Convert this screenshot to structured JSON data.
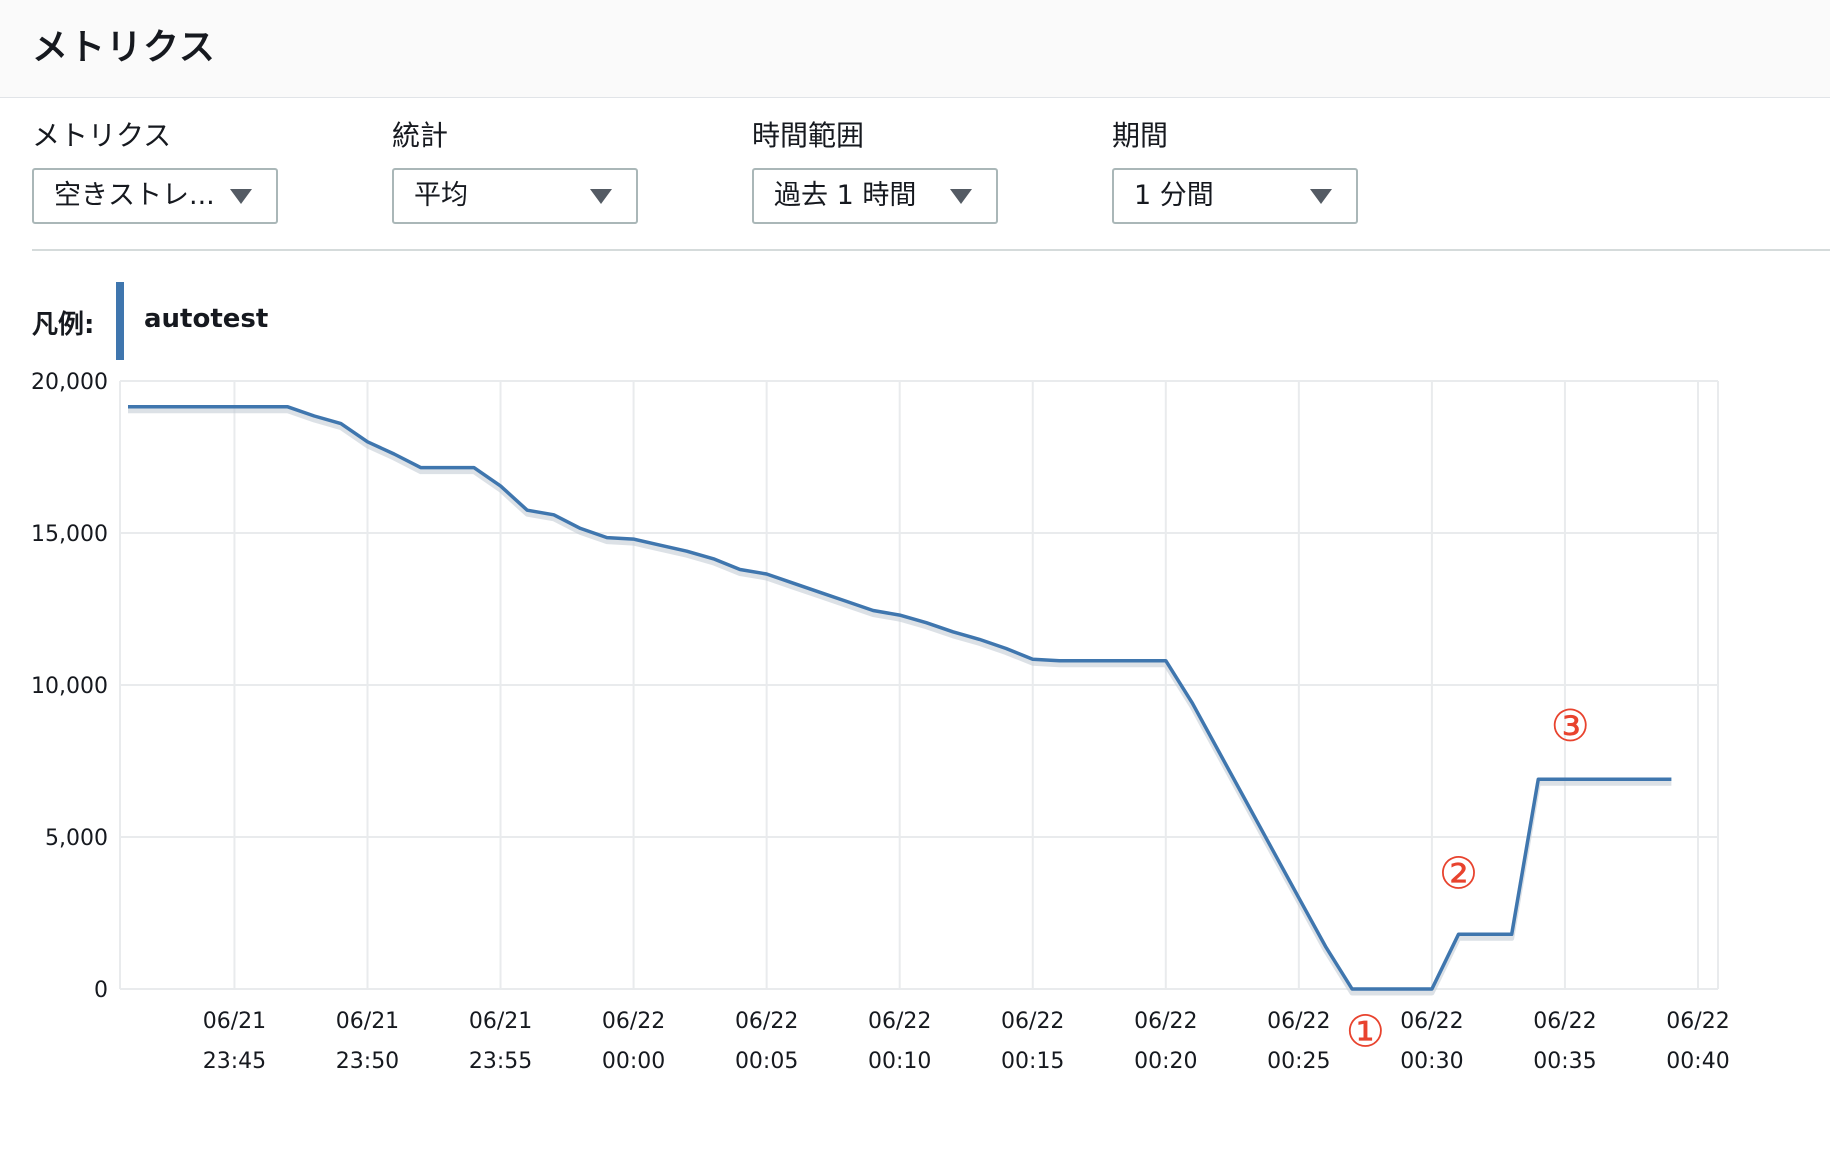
{
  "header": {
    "title": "メトリクス"
  },
  "filters": [
    {
      "label": "メトリクス",
      "value": "空きストレ..."
    },
    {
      "label": "統計",
      "value": "平均"
    },
    {
      "label": "時間範囲",
      "value": "過去 1 時間"
    },
    {
      "label": "期間",
      "value": "1 分間"
    }
  ],
  "legend": {
    "label": "凡例:",
    "series_name": "autotest"
  },
  "colors": {
    "series": "#3f76ae",
    "annotation": "#e8432e",
    "grid": "#e9ebed"
  },
  "chart_data": {
    "type": "line",
    "title": "",
    "xlabel": "",
    "ylabel": "",
    "ylim": [
      0,
      20000
    ],
    "x_range": [
      -4,
      55
    ],
    "grid": true,
    "yticks": [
      {
        "value": 0,
        "label": "0"
      },
      {
        "value": 5000,
        "label": "5,000"
      },
      {
        "value": 10000,
        "label": "10,000"
      },
      {
        "value": 15000,
        "label": "15,000"
      },
      {
        "value": 20000,
        "label": "20,000"
      }
    ],
    "xticks": [
      {
        "value": 0,
        "date": "06/21",
        "time": "23:45"
      },
      {
        "value": 5,
        "date": "06/21",
        "time": "23:50"
      },
      {
        "value": 10,
        "date": "06/21",
        "time": "23:55"
      },
      {
        "value": 15,
        "date": "06/22",
        "time": "00:00"
      },
      {
        "value": 20,
        "date": "06/22",
        "time": "00:05"
      },
      {
        "value": 25,
        "date": "06/22",
        "time": "00:10"
      },
      {
        "value": 30,
        "date": "06/22",
        "time": "00:15"
      },
      {
        "value": 35,
        "date": "06/22",
        "time": "00:20"
      },
      {
        "value": 40,
        "date": "06/22",
        "time": "00:25"
      },
      {
        "value": 45,
        "date": "06/22",
        "time": "00:30"
      },
      {
        "value": 50,
        "date": "06/22",
        "time": "00:35"
      },
      {
        "value": 55,
        "date": "06/22",
        "time": "00:40"
      }
    ],
    "series": [
      {
        "name": "autotest",
        "points": [
          [
            -4,
            19150
          ],
          [
            -3,
            19150
          ],
          [
            -2,
            19150
          ],
          [
            -1,
            19150
          ],
          [
            0,
            19150
          ],
          [
            1,
            19150
          ],
          [
            2,
            19150
          ],
          [
            3,
            18850
          ],
          [
            4,
            18600
          ],
          [
            5,
            18000
          ],
          [
            6,
            17600
          ],
          [
            7,
            17150
          ],
          [
            8,
            17150
          ],
          [
            9,
            17150
          ],
          [
            10,
            16550
          ],
          [
            11,
            15750
          ],
          [
            12,
            15600
          ],
          [
            13,
            15150
          ],
          [
            14,
            14850
          ],
          [
            15,
            14800
          ],
          [
            16,
            14600
          ],
          [
            17,
            14400
          ],
          [
            18,
            14150
          ],
          [
            19,
            13800
          ],
          [
            20,
            13650
          ],
          [
            21,
            13350
          ],
          [
            22,
            13050
          ],
          [
            23,
            12750
          ],
          [
            24,
            12450
          ],
          [
            25,
            12300
          ],
          [
            26,
            12050
          ],
          [
            27,
            11750
          ],
          [
            28,
            11500
          ],
          [
            29,
            11200
          ],
          [
            30,
            10850
          ],
          [
            31,
            10800
          ],
          [
            32,
            10800
          ],
          [
            33,
            10800
          ],
          [
            34,
            10800
          ],
          [
            35,
            10800
          ],
          [
            36,
            9400
          ],
          [
            37,
            7800
          ],
          [
            38,
            6200
          ],
          [
            39,
            4600
          ],
          [
            40,
            3000
          ],
          [
            41,
            1400
          ],
          [
            42,
            0
          ],
          [
            43,
            0
          ],
          [
            44,
            0
          ],
          [
            45,
            0
          ],
          [
            46,
            1800
          ],
          [
            47,
            1800
          ],
          [
            48,
            1800
          ],
          [
            49,
            6900
          ],
          [
            50,
            6900
          ],
          [
            51,
            6900
          ],
          [
            52,
            6900
          ],
          [
            53,
            6900
          ],
          [
            54,
            6900
          ]
        ]
      }
    ],
    "annotations": [
      {
        "text": "①",
        "x": 42.5,
        "y": -1500
      },
      {
        "text": "②",
        "x": 46,
        "y": 3700
      },
      {
        "text": "③",
        "x": 50.2,
        "y": 8550
      }
    ]
  }
}
